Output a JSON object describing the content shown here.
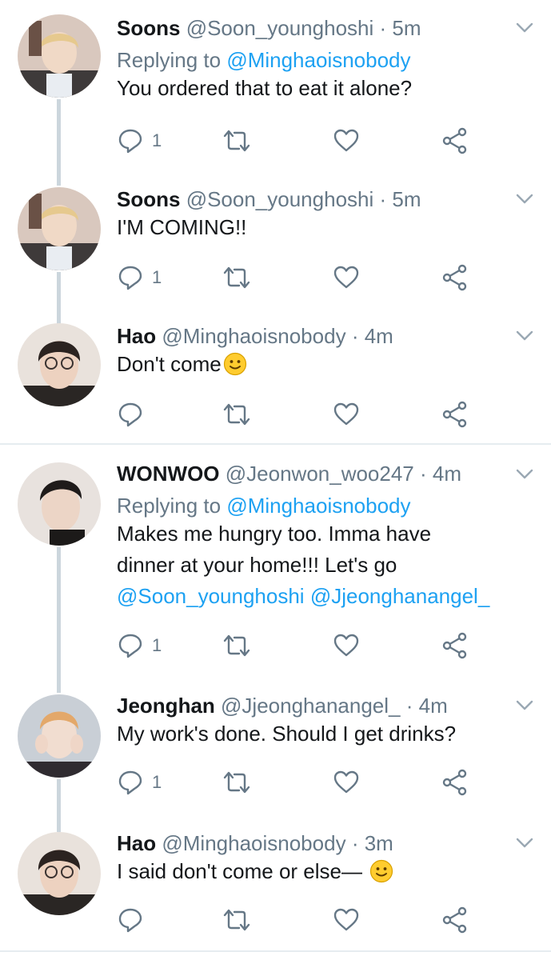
{
  "tweets": [
    {
      "name": "Soons",
      "handle": "@Soon_younghoshi",
      "separator": "·",
      "time": "5m",
      "replying_prefix": "Replying to",
      "replying_to": "@Minghaoisnobody",
      "text": "You ordered that to eat it alone?",
      "reply_count": "1"
    },
    {
      "name": "Soons",
      "handle": "@Soon_younghoshi",
      "separator": "·",
      "time": "5m",
      "text": "I'M COMING!!",
      "reply_count": "1"
    },
    {
      "name": "Hao",
      "handle": "@Minghaoisnobody",
      "separator": "·",
      "time": "4m",
      "text": "Don't come",
      "reply_count": ""
    },
    {
      "name": "WONWOO",
      "handle": "@Jeonwon_woo247",
      "separator": "·",
      "time": "4m",
      "replying_prefix": "Replying to",
      "replying_to": "@Minghaoisnobody",
      "text_line1": "Makes me hungry too. Imma have",
      "text_line2": "dinner at your home!!! Let's go",
      "mention1": "@Soon_younghoshi",
      "mention2": "@Jjeonghanangel_",
      "reply_count": "1"
    },
    {
      "name": "Jeonghan",
      "handle": "@Jjeonghanangel_",
      "separator": "·",
      "time": "4m",
      "text": "My work's done. Should I get drinks?",
      "reply_count": "1"
    },
    {
      "name": "Hao",
      "handle": "@Minghaoisnobody",
      "separator": "·",
      "time": "3m",
      "text": "I said don't come or else— ",
      "reply_count": ""
    }
  ],
  "icons": {
    "reply": "reply-icon",
    "retweet": "retweet-icon",
    "like": "heart-icon",
    "share": "share-icon",
    "more": "chevron-down-icon",
    "emoji": "smiling-face-emoji"
  },
  "colors": {
    "mention": "#1da1f2",
    "secondary_text": "#657786",
    "thread_line": "#ccd6dd"
  }
}
